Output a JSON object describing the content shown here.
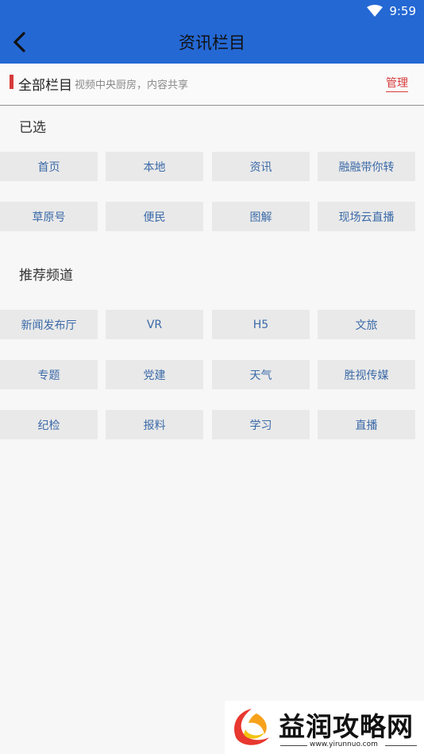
{
  "status_bar": {
    "time": "9:59"
  },
  "header": {
    "title": "资讯栏目"
  },
  "section": {
    "title": "全部栏目",
    "subtitle": "视频中央厨房，内容共享",
    "manage_label": "管理"
  },
  "selected": {
    "label": "已选",
    "items": [
      "首页",
      "本地",
      "资讯",
      "融融带你转",
      "草原号",
      "便民",
      "图解",
      "现场云直播"
    ]
  },
  "recommended": {
    "label": "推荐频道",
    "items": [
      "新闻发布厅",
      "VR",
      "H5",
      "文旅",
      "专题",
      "党建",
      "天气",
      "胜视传媒",
      "纪检",
      "报料",
      "学习",
      "直播"
    ]
  },
  "watermark": {
    "text": "益润攻略网",
    "url": "www.yirunnuo.com"
  },
  "colors": {
    "header_bg": "#2468d4",
    "accent_red": "#d63b3b",
    "chip_text": "#3b6aa8",
    "chip_bg": "#e9e9e9"
  }
}
